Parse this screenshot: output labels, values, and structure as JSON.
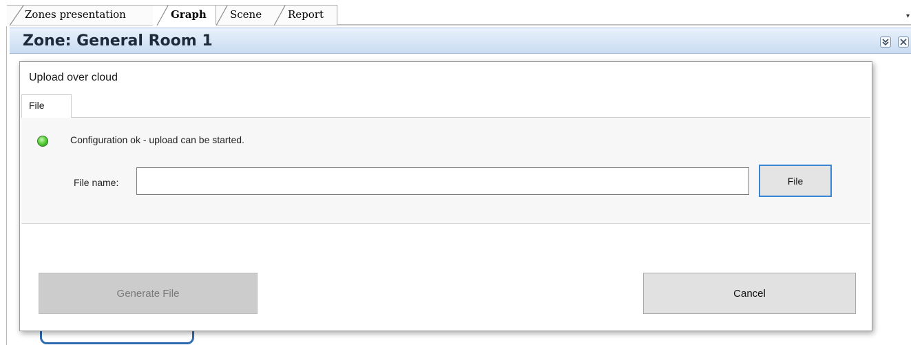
{
  "tabs": [
    {
      "label": "Zones presentation",
      "active": false
    },
    {
      "label": "Graph",
      "active": true
    },
    {
      "label": "Scene",
      "active": false
    },
    {
      "label": "Report",
      "active": false
    }
  ],
  "zone": {
    "title": "Zone: General Room 1",
    "collapse_icon": "double-chevron-down-icon",
    "close_icon": "close-icon"
  },
  "dialog": {
    "title": "Upload over cloud",
    "tab_label": "File",
    "status": {
      "icon": "green-status-led-icon",
      "color": "#3cc12a",
      "text": "Configuration ok - upload can be started."
    },
    "file_name_label": "File name:",
    "file_name_value": "",
    "file_button_label": "File",
    "generate_button_label": "Generate File",
    "generate_button_enabled": false,
    "cancel_button_label": "Cancel"
  },
  "colors": {
    "header_gradient_top": "#e9f1fb",
    "header_gradient_bottom": "#c9dcf2",
    "focus_blue": "#3b86d4"
  }
}
